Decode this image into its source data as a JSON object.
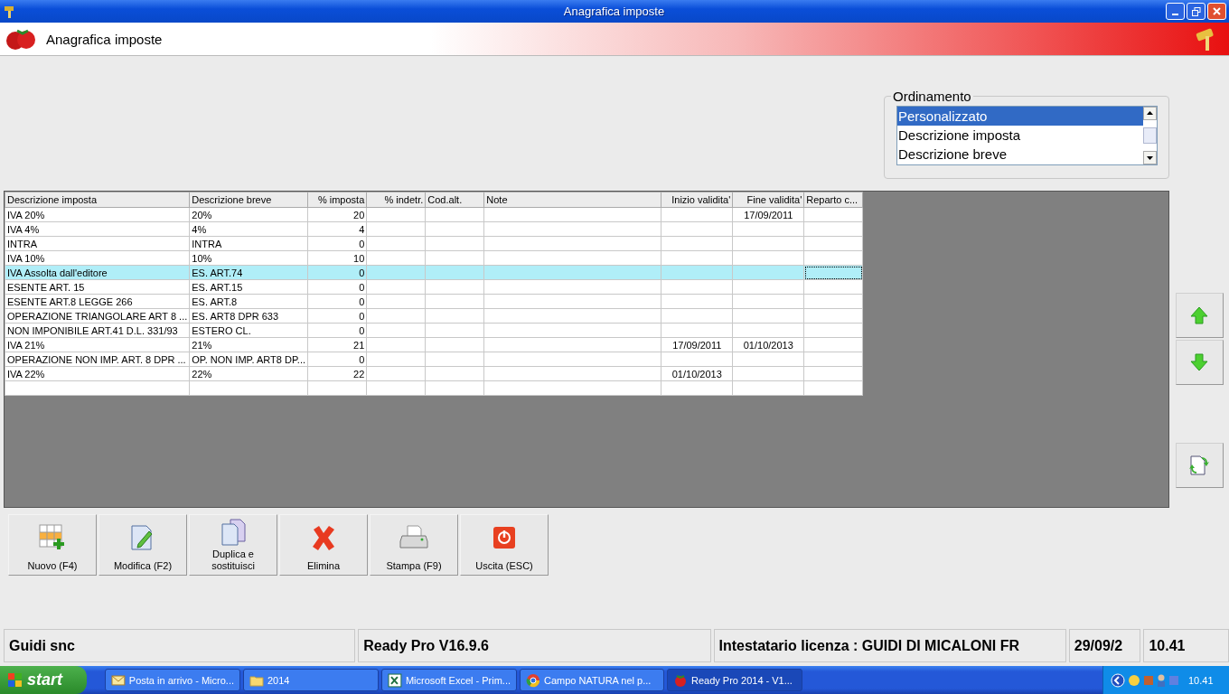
{
  "window": {
    "title": "Anagrafica imposte"
  },
  "header": {
    "title": "Anagrafica imposte"
  },
  "sorting": {
    "label": "Ordinamento",
    "items": [
      {
        "label": "Personalizzato",
        "selected": true
      },
      {
        "label": "Descrizione imposta",
        "selected": false
      },
      {
        "label": "Descrizione breve",
        "selected": false
      }
    ]
  },
  "table": {
    "columns": [
      "Descrizione imposta",
      "Descrizione breve",
      "% imposta",
      "% indetr.",
      "Cod.alt.",
      "Note",
      "Inizio validita'",
      "Fine validita'",
      "Reparto c..."
    ],
    "rows": [
      {
        "cells": [
          "IVA 20%",
          "20%",
          "20",
          "",
          "",
          "",
          "",
          "17/09/2011",
          ""
        ],
        "selected": false
      },
      {
        "cells": [
          "IVA 4%",
          "4%",
          "4",
          "",
          "",
          "",
          "",
          "",
          ""
        ],
        "selected": false
      },
      {
        "cells": [
          "INTRA",
          "INTRA",
          "0",
          "",
          "",
          "",
          "",
          "",
          ""
        ],
        "selected": false
      },
      {
        "cells": [
          "IVA 10%",
          "10%",
          "10",
          "",
          "",
          "",
          "",
          "",
          ""
        ],
        "selected": false
      },
      {
        "cells": [
          "IVA Assolta dall'editore",
          "ES. ART.74",
          "0",
          "",
          "",
          "",
          "",
          "",
          ""
        ],
        "selected": true
      },
      {
        "cells": [
          "ESENTE ART. 15",
          "ES. ART.15",
          "0",
          "",
          "",
          "",
          "",
          "",
          ""
        ],
        "selected": false
      },
      {
        "cells": [
          "ESENTE ART.8 LEGGE 266",
          "ES. ART.8",
          "0",
          "",
          "",
          "",
          "",
          "",
          ""
        ],
        "selected": false
      },
      {
        "cells": [
          "OPERAZIONE TRIANGOLARE ART 8 ...",
          "ES. ART8 DPR 633",
          "0",
          "",
          "",
          "",
          "",
          "",
          ""
        ],
        "selected": false
      },
      {
        "cells": [
          "NON IMPONIBILE ART.41 D.L. 331/93",
          "ESTERO CL.",
          "0",
          "",
          "",
          "",
          "",
          "",
          ""
        ],
        "selected": false
      },
      {
        "cells": [
          "IVA 21%",
          "21%",
          "21",
          "",
          "",
          "",
          "17/09/2011",
          "01/10/2013",
          ""
        ],
        "selected": false
      },
      {
        "cells": [
          "OPERAZIONE NON IMP. ART. 8 DPR ...",
          "OP. NON IMP. ART8 DP...",
          "0",
          "",
          "",
          "",
          "",
          "",
          ""
        ],
        "selected": false
      },
      {
        "cells": [
          "IVA 22%",
          "22%",
          "22",
          "",
          "",
          "",
          "01/10/2013",
          "",
          ""
        ],
        "selected": false
      },
      {
        "cells": [
          "",
          "",
          "",
          "",
          "",
          "",
          "",
          "",
          ""
        ],
        "selected": false
      }
    ]
  },
  "buttons": [
    "Nuovo (F4)",
    "Modifica (F2)",
    "Duplica e sostituisci",
    "Elimina",
    "Stampa (F9)",
    "Uscita (ESC)"
  ],
  "status_bar": [
    "Guidi snc",
    "Ready Pro V16.9.6",
    "Intestatario licenza : GUIDI DI MICALONI FR",
    "29/09/2",
    "10.41"
  ],
  "taskbar": {
    "start": "start",
    "items": [
      {
        "label": "Posta in arrivo - Micro...",
        "selected": false
      },
      {
        "label": "2014",
        "selected": false
      },
      {
        "label": "Microsoft Excel - Prim...",
        "selected": false
      },
      {
        "label": "Campo NATURA nel p...",
        "selected": false
      },
      {
        "label": "Ready Pro 2014 - V1...",
        "selected": true
      }
    ],
    "clock": "10.41"
  }
}
